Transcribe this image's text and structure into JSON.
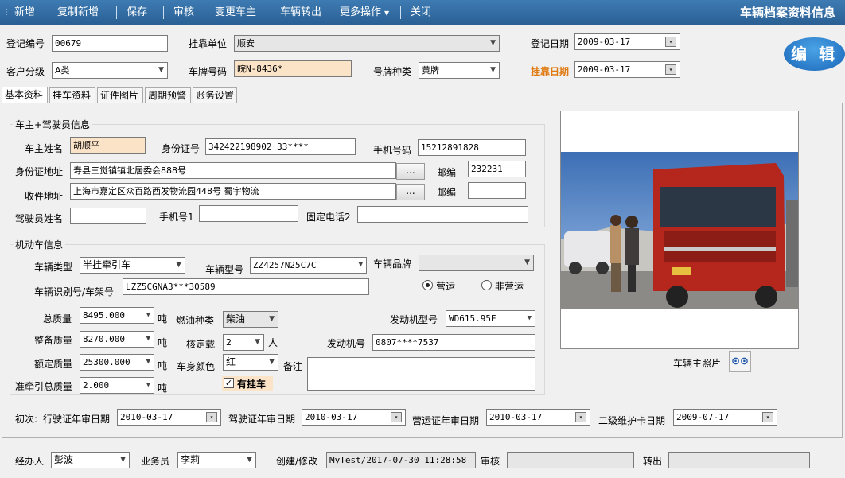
{
  "toolbar": {
    "items": [
      "新增",
      "复制新增",
      "保存",
      "审核",
      "变更车主",
      "车辆转出",
      "更多操作",
      "关闭"
    ],
    "title": "车辆档案资料信息"
  },
  "header": {
    "reg_no_label": "登记编号",
    "reg_no": "00679",
    "affil_label": "挂靠单位",
    "affil": "顺安",
    "reg_date_label": "登记日期",
    "reg_date": "2009-03-17",
    "cust_level_label": "客户分级",
    "cust_level": "A类",
    "plate_label": "车牌号码",
    "plate": "皖N-8436*",
    "plate_type_label": "号牌种类",
    "plate_type": "黄牌",
    "affil_date_label": "挂靠日期",
    "affil_date": "2009-03-17",
    "edit_label": "编 辑"
  },
  "tabs": [
    "基本资料",
    "挂车资料",
    "证件图片",
    "周期预警",
    "账务设置"
  ],
  "owner": {
    "group_title": "车主+驾驶员信息",
    "name_label": "车主姓名",
    "name": "胡顺平",
    "id_label": "身份证号",
    "id": "342422198902 33****",
    "phone_label": "手机号码",
    "phone": "15212891828",
    "id_addr_label": "身份证地址",
    "id_addr": "寿县三觉镇镇北居委会888号",
    "zip_label": "邮编",
    "zip": "232231",
    "recv_addr_label": "收件地址",
    "recv_addr": "上海市嘉定区众百路西发物流园448号 蜀宇物流",
    "zip2_label": "邮编",
    "zip2": "",
    "driver_label": "驾驶员姓名",
    "driver": "",
    "mobile1_label": "手机号1",
    "mobile1": "",
    "tel2_label": "固定电话2",
    "tel2": "",
    "dots": "..."
  },
  "vehicle": {
    "group_title": "机动车信息",
    "type_label": "车辆类型",
    "type": "半挂牵引车",
    "model_label": "车辆型号",
    "model": "ZZ4257N25C7C",
    "brand_label": "车辆品牌",
    "brand": "",
    "vin_label": "车辆识别号/车架号",
    "vin": "LZZ5CGNA3***30589",
    "op_label": "营运",
    "nonop_label": "非营运",
    "total_mass_label": "总质量",
    "total_mass": "8495.000",
    "unit_t": "吨",
    "fuel_label": "燃油种类",
    "fuel": "柴油",
    "engine_model_label": "发动机型号",
    "engine_model": "WD615.95E",
    "curb_mass_label": "整备质量",
    "curb_mass": "8270.000",
    "seats_label": "核定载",
    "seats": "2",
    "unit_p": "人",
    "engine_no_label": "发动机号",
    "engine_no": "0807****7537",
    "rated_mass_label": "额定质量",
    "rated_mass": "25300.000",
    "color_label": "车身颜色",
    "color": "红",
    "remark_label": "备注",
    "trac_mass_label": "准牵引总质量",
    "trac_mass": "2.000",
    "trailer_label": "有挂车"
  },
  "photo": {
    "label": "车辆主照片"
  },
  "dates": {
    "first_label": "初次:",
    "license_label": "行驶证年审日期",
    "license": "2010-03-17",
    "driver_label": "驾驶证年审日期",
    "driver": "2010-03-17",
    "op_label": "营运证年审日期",
    "op": "2010-03-17",
    "maint_label": "二级维护卡日期",
    "maint": "2009-07-17"
  },
  "footer": {
    "handler_label": "经办人",
    "handler": "彭波",
    "sales_label": "业务员",
    "sales": "李莉",
    "created_label": "创建/修改",
    "created": "MyTest/2017-07-30 11:28:58",
    "audit_label": "审核",
    "audit": "",
    "out_label": "转出",
    "out": ""
  }
}
